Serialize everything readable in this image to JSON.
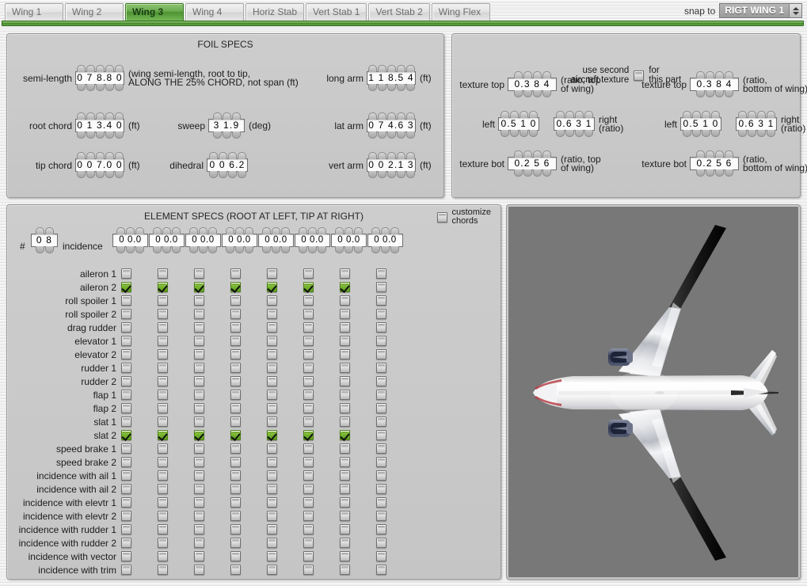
{
  "tabs": [
    {
      "label": "Wing 1",
      "active": false
    },
    {
      "label": "Wing 2",
      "active": false
    },
    {
      "label": "Wing 3",
      "active": true
    },
    {
      "label": "Wing 4",
      "active": false
    },
    {
      "label": "Horiz Stab",
      "active": false
    },
    {
      "label": "Vert Stab 1",
      "active": false
    },
    {
      "label": "Vert Stab 2",
      "active": false
    },
    {
      "label": "Wing Flex",
      "active": false
    }
  ],
  "snap": {
    "label": "snap to",
    "value": "RIGT WING 1"
  },
  "foil": {
    "title": "FOIL SPECS",
    "fields": [
      {
        "label": "semi-length",
        "value": "0 7 8.8 0",
        "unit": "(wing semi-length, root to tip,\nALONG THE 25% CHORD, not span (ft)",
        "spinners": 5
      },
      {
        "label": "root chord",
        "value": "0 1 3.4 0",
        "unit": "(ft)",
        "spinners": 5
      },
      {
        "label": "tip chord",
        "value": "0 0 7.0 0",
        "unit": "(ft)",
        "spinners": 5
      },
      {
        "label": "sweep",
        "value": "3 1.9",
        "unit": "(deg)",
        "spinners": 3
      },
      {
        "label": "dihedral",
        "value": "0 0 6.2",
        "unit": "",
        "spinners": 4
      },
      {
        "label": "long arm",
        "value": "1 1 8.5 4",
        "unit": "(ft)",
        "spinners": 5
      },
      {
        "label": "lat arm",
        "value": "0 7 4.6 3",
        "unit": "(ft)",
        "spinners": 5
      },
      {
        "label": "vert arm",
        "value": "0 0 2.1 3",
        "unit": "(ft)",
        "spinners": 5
      }
    ]
  },
  "texture": {
    "second_texture": {
      "line1": "use second",
      "line2": "aircraft texture",
      "after1": "for",
      "after2": "this part",
      "checked": false
    },
    "left_group": [
      {
        "label": "texture top",
        "value": "0.3 8 4",
        "unit": "(ratio, top\nof wing)",
        "spinners": 4
      },
      {
        "label": "left",
        "value": "0.5 1 0",
        "unit": "",
        "spinners": 4
      },
      {
        "label": "",
        "value": "0.6 3 1",
        "unit": "right\n(ratio)",
        "spinners": 4
      },
      {
        "label": "texture bot",
        "value": "0.2 5 6",
        "unit": "(ratio, top\nof wing)",
        "spinners": 4
      }
    ],
    "right_group": [
      {
        "label": "texture top",
        "value": "0.3 8 4",
        "unit": "(ratio,\nbottom of wing)",
        "spinners": 4
      },
      {
        "label": "left",
        "value": "0.5 1 0",
        "unit": "",
        "spinners": 4
      },
      {
        "label": "",
        "value": "0.6 3 1",
        "unit": "right\n(ratio)",
        "spinners": 4
      },
      {
        "label": "texture bot",
        "value": "0.2 5 6",
        "unit": "(ratio,\nbottom of wing)",
        "spinners": 4
      }
    ]
  },
  "elements": {
    "title": "ELEMENT SPECS (ROOT AT LEFT, TIP AT RIGHT)",
    "customize": {
      "line1": "customize",
      "line2": "chords",
      "checked": false
    },
    "hash_label": "#",
    "count_value": "0 8",
    "incidence_label": "incidence",
    "incidence_values": [
      "0 0.0",
      "0 0.0",
      "0 0.0",
      "0 0.0",
      "0 0.0",
      "0 0.0",
      "0 0.0",
      "0 0.0"
    ],
    "rows": [
      {
        "label": "aileron 1",
        "checks": [
          false,
          false,
          false,
          false,
          false,
          false,
          false,
          false
        ]
      },
      {
        "label": "aileron 2",
        "checks": [
          true,
          true,
          true,
          true,
          true,
          true,
          true,
          false
        ]
      },
      {
        "label": "roll spoiler 1",
        "checks": [
          false,
          false,
          false,
          false,
          false,
          false,
          false,
          false
        ]
      },
      {
        "label": "roll spoiler 2",
        "checks": [
          false,
          false,
          false,
          false,
          false,
          false,
          false,
          false
        ]
      },
      {
        "label": "drag rudder",
        "checks": [
          false,
          false,
          false,
          false,
          false,
          false,
          false,
          false
        ]
      },
      {
        "label": "elevator 1",
        "checks": [
          false,
          false,
          false,
          false,
          false,
          false,
          false,
          false
        ]
      },
      {
        "label": "elevator 2",
        "checks": [
          false,
          false,
          false,
          false,
          false,
          false,
          false,
          false
        ]
      },
      {
        "label": "rudder 1",
        "checks": [
          false,
          false,
          false,
          false,
          false,
          false,
          false,
          false
        ]
      },
      {
        "label": "rudder 2",
        "checks": [
          false,
          false,
          false,
          false,
          false,
          false,
          false,
          false
        ]
      },
      {
        "label": "flap 1",
        "checks": [
          false,
          false,
          false,
          false,
          false,
          false,
          false,
          false
        ]
      },
      {
        "label": "flap 2",
        "checks": [
          false,
          false,
          false,
          false,
          false,
          false,
          false,
          false
        ]
      },
      {
        "label": "slat 1",
        "checks": [
          false,
          false,
          false,
          false,
          false,
          false,
          false,
          false
        ]
      },
      {
        "label": "slat 2",
        "checks": [
          true,
          true,
          true,
          true,
          true,
          true,
          true,
          false
        ]
      },
      {
        "label": "speed brake 1",
        "checks": [
          false,
          false,
          false,
          false,
          false,
          false,
          false,
          false
        ]
      },
      {
        "label": "speed brake 2",
        "checks": [
          false,
          false,
          false,
          false,
          false,
          false,
          false,
          false
        ]
      },
      {
        "label": "incidence with ail 1",
        "checks": [
          false,
          false,
          false,
          false,
          false,
          false,
          false,
          false
        ]
      },
      {
        "label": "incidence with ail 2",
        "checks": [
          false,
          false,
          false,
          false,
          false,
          false,
          false,
          false
        ]
      },
      {
        "label": "incidence with elevtr 1",
        "checks": [
          false,
          false,
          false,
          false,
          false,
          false,
          false,
          false
        ]
      },
      {
        "label": "incidence with elevtr 2",
        "checks": [
          false,
          false,
          false,
          false,
          false,
          false,
          false,
          false
        ]
      },
      {
        "label": "incidence with rudder 1",
        "checks": [
          false,
          false,
          false,
          false,
          false,
          false,
          false,
          false
        ]
      },
      {
        "label": "incidence with rudder 2",
        "checks": [
          false,
          false,
          false,
          false,
          false,
          false,
          false,
          false
        ]
      },
      {
        "label": "incidence with vector",
        "checks": [
          false,
          false,
          false,
          false,
          false,
          false,
          false,
          false
        ]
      },
      {
        "label": "incidence with trim",
        "checks": [
          false,
          false,
          false,
          false,
          false,
          false,
          false,
          false
        ]
      }
    ]
  },
  "viewport": {
    "background_color": "#787878",
    "aircraft": "twin-engine airliner, top-down plan view, white fuselage, dark wingtips"
  }
}
